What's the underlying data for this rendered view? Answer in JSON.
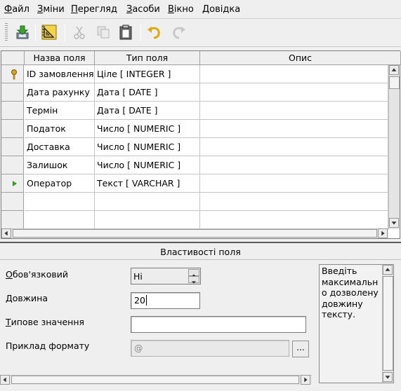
{
  "menu": [
    "Файл",
    "Зміни",
    "Перегляд",
    "Засоби",
    "Вікно",
    "Довідка"
  ],
  "toolbar_icons": [
    "save-icon",
    "design-ruler-icon",
    "cut-icon",
    "copy-icon",
    "paste-icon",
    "undo-icon",
    "redo-icon"
  ],
  "table": {
    "columns": [
      "Назва поля",
      "Тип поля",
      "Опис"
    ],
    "rows": [
      {
        "marker": "key",
        "name": "ID замовлення",
        "type": "Ціле [ INTEGER ]",
        "desc": ""
      },
      {
        "marker": "",
        "name": "Дата рахунку",
        "type": "Дата [ DATE ]",
        "desc": ""
      },
      {
        "marker": "",
        "name": "Термін",
        "type": "Дата [ DATE ]",
        "desc": ""
      },
      {
        "marker": "",
        "name": "Податок",
        "type": "Число [ NUMERIC ]",
        "desc": ""
      },
      {
        "marker": "",
        "name": "Доставка",
        "type": "Число [ NUMERIC ]",
        "desc": ""
      },
      {
        "marker": "",
        "name": "Залишок",
        "type": "Число [ NUMERIC ]",
        "desc": ""
      },
      {
        "marker": "current",
        "name": "Оператор",
        "type": "Текст [ VARCHAR ]",
        "desc": ""
      },
      {
        "marker": "",
        "name": "",
        "type": "",
        "desc": ""
      },
      {
        "marker": "",
        "name": "",
        "type": "",
        "desc": ""
      }
    ]
  },
  "properties": {
    "title": "Властивості поля",
    "required_label": "Обов'язковий",
    "required_value": "Ні",
    "length_label": "Довжина",
    "length_value": "20",
    "default_label": "Типове значення",
    "default_value": "",
    "format_label": "Приклад формату",
    "format_value": "@",
    "format_button": "...",
    "help_text": "Введіть максимально дозволену довжину тексту."
  },
  "colors": {
    "key_icon": "#d8a32a",
    "current_row_marker": "#3a9a1a",
    "undo_icon": "#e0a800"
  }
}
